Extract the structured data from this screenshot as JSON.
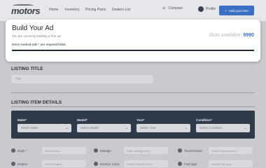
{
  "nav": {
    "logo": "motors",
    "links": [
      "Home",
      "Inventory",
      "Pricing Plans",
      "Dealers List"
    ],
    "compare_label": "Compare",
    "profile_label": "Profile",
    "add_button_label": "Add your item"
  },
  "modal": {
    "title": "Build Your Ad",
    "subtitle": "You are currently building a free ad.",
    "required_note": "Items marked with * are required fields.",
    "slots_label": "Slots available:",
    "slots_value": "9990"
  },
  "listing_title": {
    "heading": "LISTING TITLE",
    "placeholder": "Title"
  },
  "listing_details": {
    "heading": "LISTING ITEM DETAILS",
    "selects": [
      {
        "label": "Make*",
        "placeholder": "Select Make"
      },
      {
        "label": "Model*",
        "placeholder": "Select Model"
      },
      {
        "label": "Year*",
        "placeholder": "Select Year"
      },
      {
        "label": "Condition*",
        "placeholder": "Select Condition"
      }
    ]
  },
  "specs": {
    "row1": [
      {
        "label": "Body *",
        "placeholder": "Select Body"
      },
      {
        "label": "Mileage",
        "placeholder": "Enter Mileage (mi)"
      },
      {
        "label": "Transmission",
        "placeholder": "Select Transmission"
      }
    ],
    "row2": [
      {
        "label": "Engine",
        "placeholder": "Select Engine"
      },
      {
        "label": "Exterior Color",
        "placeholder": "Select Exterior Color"
      },
      {
        "label": "Fuel type",
        "placeholder": "Select Fuel type"
      }
    ]
  }
}
